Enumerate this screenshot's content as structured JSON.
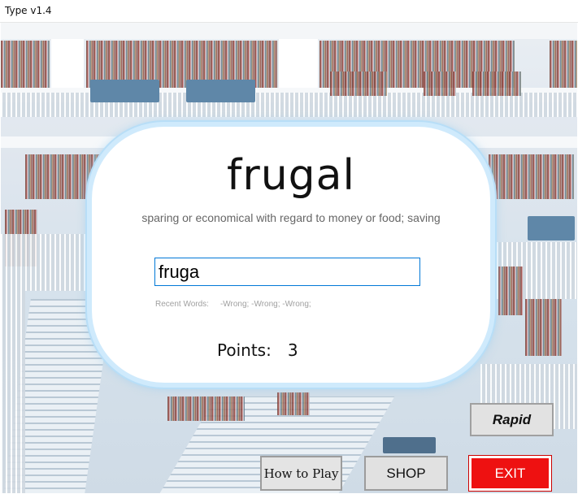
{
  "window": {
    "title": "Type v1.4"
  },
  "card": {
    "word": "frugal",
    "definition": "sparing or economical with regard to money or food; saving",
    "input_value": "fruga",
    "recent_label": "Recent Words:",
    "recent_values": "-Wrong; -Wrong; -Wrong;",
    "points_label": "Points:",
    "points_value": "3"
  },
  "buttons": {
    "rapid": "Rapid",
    "how_to_play": "How to Play",
    "shop": "SHOP",
    "exit": "EXIT"
  },
  "colors": {
    "exit_bg": "#ee1111",
    "card_border": "#cfeafc",
    "input_border": "#0078d7"
  },
  "icons": {
    "background": "library-background-image"
  }
}
